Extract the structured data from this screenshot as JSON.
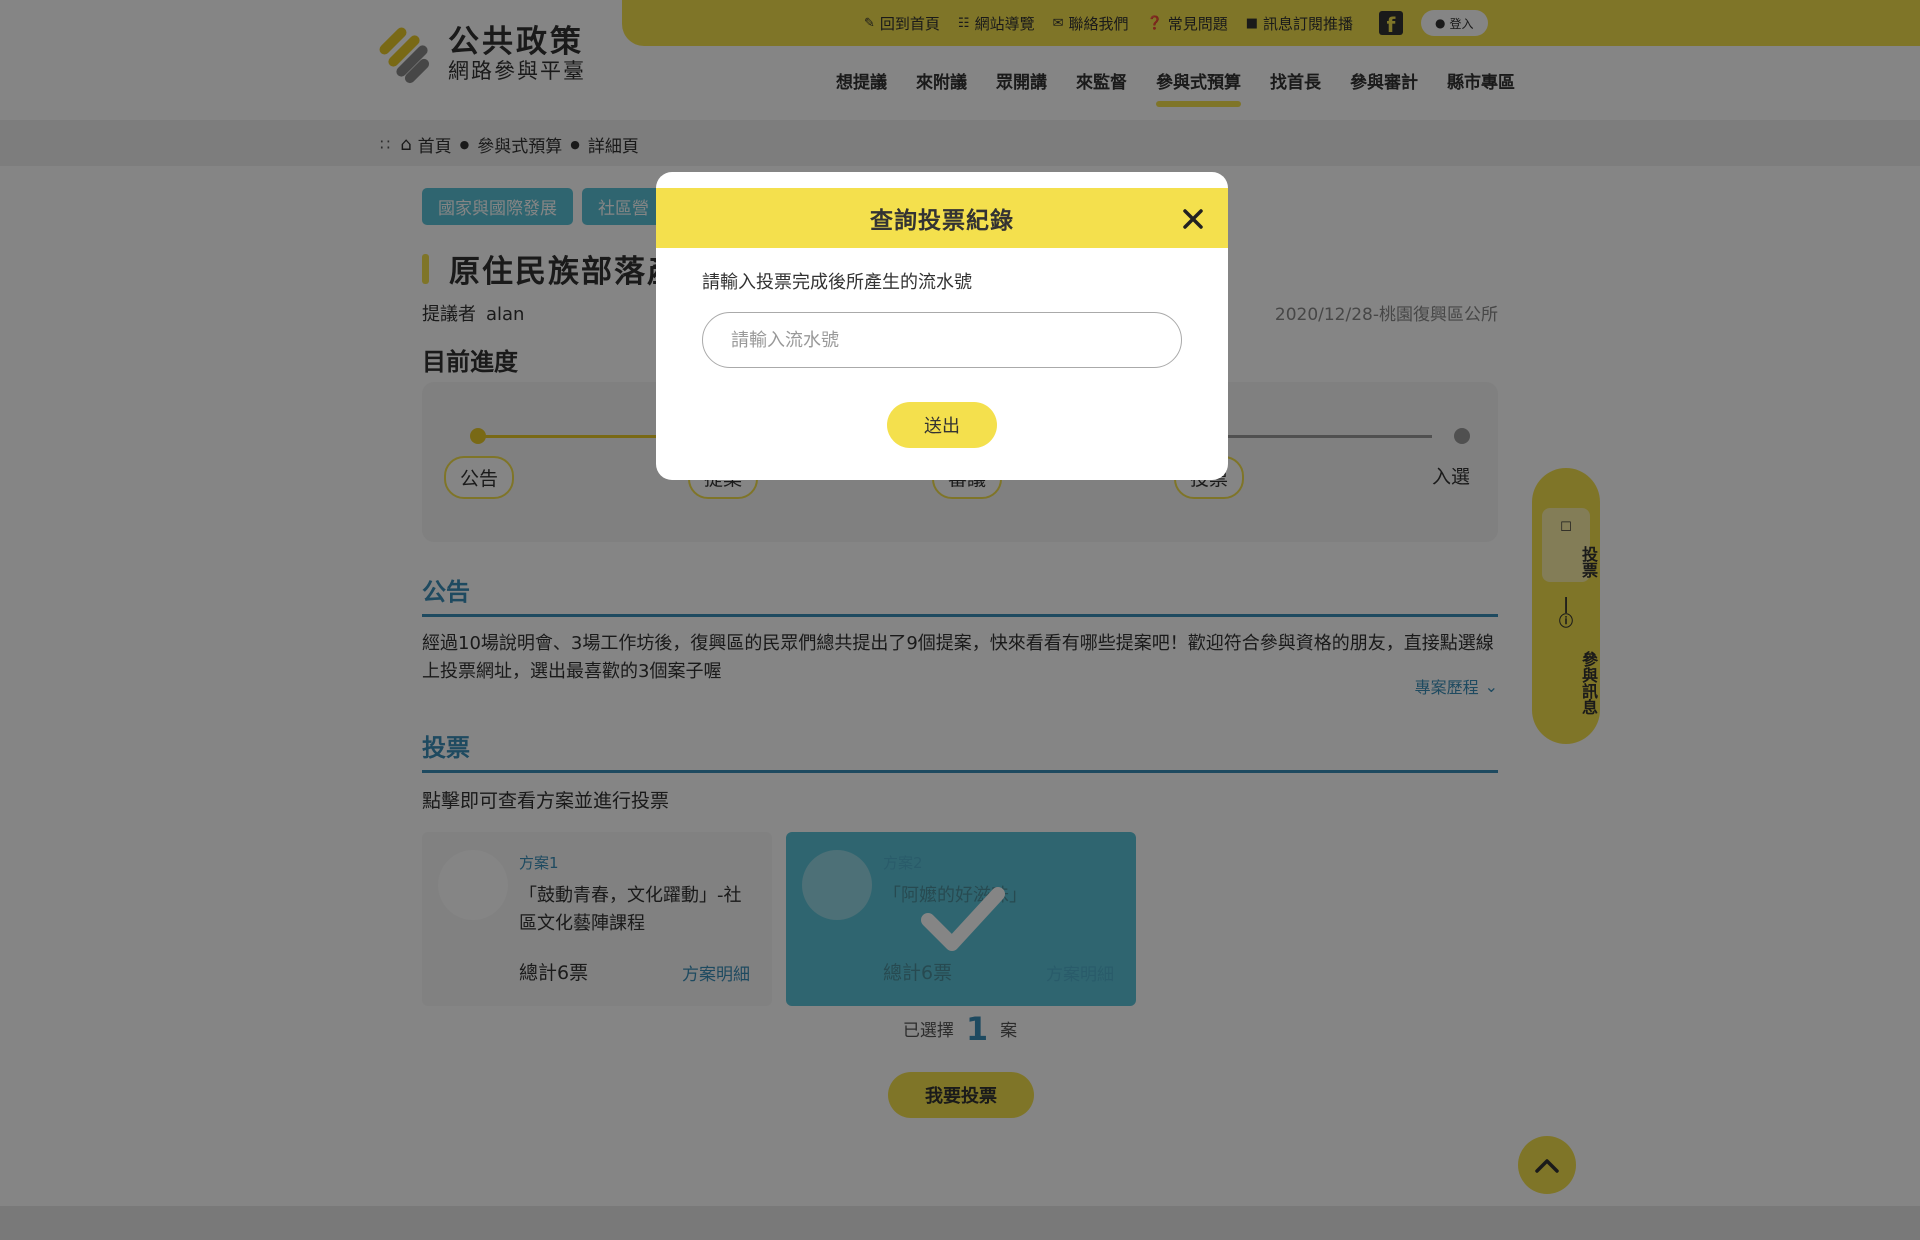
{
  "header": {
    "logo_title": "公共政策",
    "logo_subtitle": "網路參與平臺",
    "utility_links": [
      {
        "label": "回到首頁",
        "icon": "home-link-icon"
      },
      {
        "label": "網站導覽",
        "icon": "sitemap-icon"
      },
      {
        "label": "聯絡我們",
        "icon": "mail-icon"
      },
      {
        "label": "常見問題",
        "icon": "question-icon"
      },
      {
        "label": "訊息訂閱推播",
        "icon": "chat-icon"
      }
    ],
    "login_label": "登入",
    "nav": [
      {
        "label": "想提議",
        "active": false
      },
      {
        "label": "來附議",
        "active": false
      },
      {
        "label": "眾開講",
        "active": false
      },
      {
        "label": "來監督",
        "active": false
      },
      {
        "label": "參與式預算",
        "active": true
      },
      {
        "label": "找首長",
        "active": false
      },
      {
        "label": "參與審計",
        "active": false
      },
      {
        "label": "縣市專區",
        "active": false
      }
    ]
  },
  "breadcrumb": [
    "首頁",
    "參與式預算",
    "詳細頁"
  ],
  "page": {
    "tags": [
      "國家與國際發展",
      "社區營"
    ],
    "title": "原住民族部落產",
    "proposer_label": "提議者",
    "proposer_name": "alan",
    "date_org": "2020/12/28-桃園復興區公所",
    "progress_title": "目前進度",
    "progress_steps": [
      "公告",
      "提案",
      "審議",
      "投票",
      "入選"
    ],
    "announcement_heading": "公告",
    "announcement_text": "經過10場說明會、3場工作坊後，復興區的民眾們總共提出了9個提案，快來看看有哪些提案吧！歡迎符合參與資格的朋友，直接點選線上投票網址，選出最喜歡的3個案子喔",
    "history_link": "專案歷程",
    "vote_heading": "投票",
    "vote_hint": "點擊即可查看方案並進行投票",
    "cards": [
      {
        "num": "方案1",
        "title": "「鼓動青春，文化躍動」-社區文化藝陣課程",
        "total": "總計6票",
        "detail": "方案明細",
        "selected": false
      },
      {
        "num": "方案2",
        "title": "「阿嬤的好滋味」",
        "total": "總計6票",
        "detail": "方案明細",
        "selected": true
      }
    ],
    "selected_prefix": "已選擇",
    "selected_count": "1",
    "selected_suffix": "案",
    "vote_button": "我要投票",
    "side_tab_vote": "投票",
    "side_tab_info": "參與訊息"
  },
  "modal": {
    "title": "查詢投票紀錄",
    "label": "請輸入投票完成後所產生的流水號",
    "placeholder": "請輸入流水號",
    "input_value": "",
    "submit": "送出"
  },
  "colors": {
    "accent_yellow": "#f4e04d",
    "accent_blue": "#3b8eb8",
    "tag_teal": "#5bc2d6"
  }
}
